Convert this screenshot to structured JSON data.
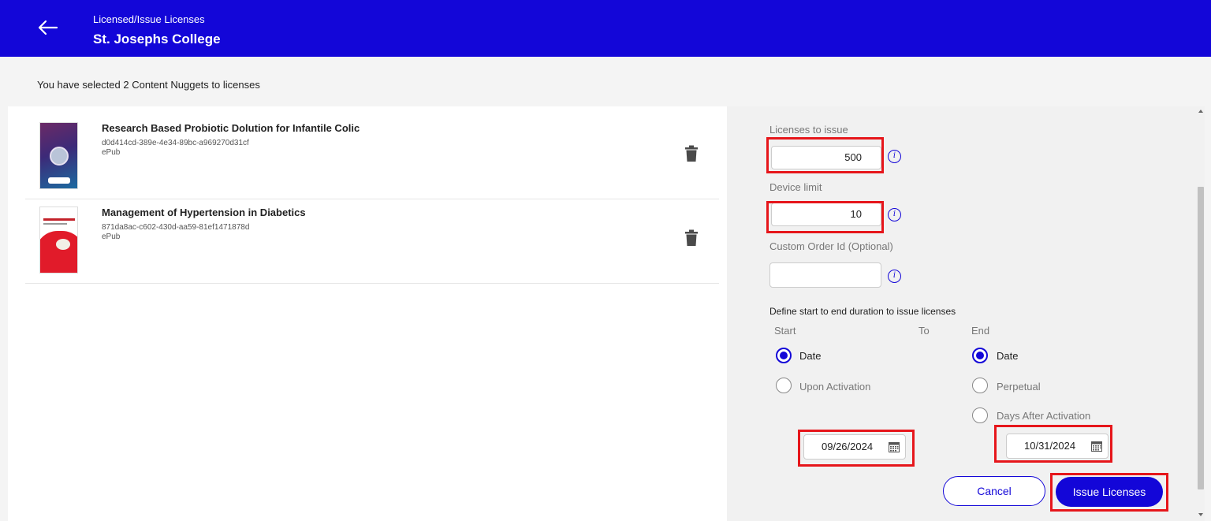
{
  "header": {
    "breadcrumb": "Licensed/Issue Licenses",
    "title": "St. Josephs College",
    "background": "#1306d8"
  },
  "summary": "You have selected 2 Content Nuggets to licenses",
  "items": [
    {
      "title": "Research Based Probiotic Dolution for Infantile Colic",
      "id": "d0d414cd-389e-4e34-89bc-a969270d31cf",
      "format": "ePub",
      "thumbnail_icon": "book-cover-probiotic"
    },
    {
      "title": "Management of Hypertension in Diabetics",
      "id": "871da8ac-c602-430d-aa59-81ef1471878d",
      "format": "ePub",
      "thumbnail_icon": "book-cover-hypertension"
    }
  ],
  "form": {
    "licenses_label": "Licenses to issue",
    "licenses_value": "500",
    "device_label": "Device limit",
    "device_value": "10",
    "order_label": "Custom Order Id (Optional)",
    "order_value": "",
    "info_glyph": "i",
    "duration_title": "Define start to end duration to issue licenses",
    "start_label": "Start",
    "to_label": "To",
    "end_label": "End",
    "start_options": [
      {
        "label": "Date",
        "selected": true
      },
      {
        "label": "Upon Activation",
        "selected": false
      }
    ],
    "end_options": [
      {
        "label": "Date",
        "selected": true
      },
      {
        "label": "Perpetual",
        "selected": false
      },
      {
        "label": "Days After Activation",
        "selected": false
      }
    ],
    "start_date": "09/26/2024",
    "end_date": "10/31/2024"
  },
  "buttons": {
    "cancel": "Cancel",
    "issue": "Issue Licenses"
  },
  "colors": {
    "accent": "#1306d8",
    "highlight": "#e6161b"
  }
}
